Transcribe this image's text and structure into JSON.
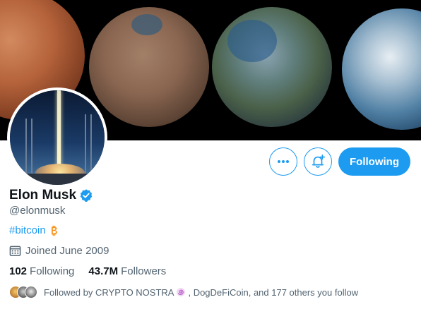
{
  "profile": {
    "name": "Elon Musk",
    "handle": "@elonmusk",
    "bio_hashtag": "#bitcoin",
    "joined": "Joined June 2009",
    "following_count": "102",
    "following_label": "Following",
    "followers_count": "43.7M",
    "followers_label": "Followers"
  },
  "actions": {
    "follow_label": "Following"
  },
  "followed_by": {
    "prefix": "Followed by CRYPTO NOSTRA",
    "suffix": ", DogDeFiCoin, and 177 others you follow"
  },
  "icons": {
    "verified": "verified-badge-icon",
    "bitcoin": "bitcoin-icon",
    "calendar": "calendar-icon",
    "more": "more-icon",
    "bell": "notification-bell-add-icon"
  },
  "colors": {
    "accent": "#1d9bf0",
    "bitcoin": "#f7931a",
    "secondary_text": "#536471"
  }
}
